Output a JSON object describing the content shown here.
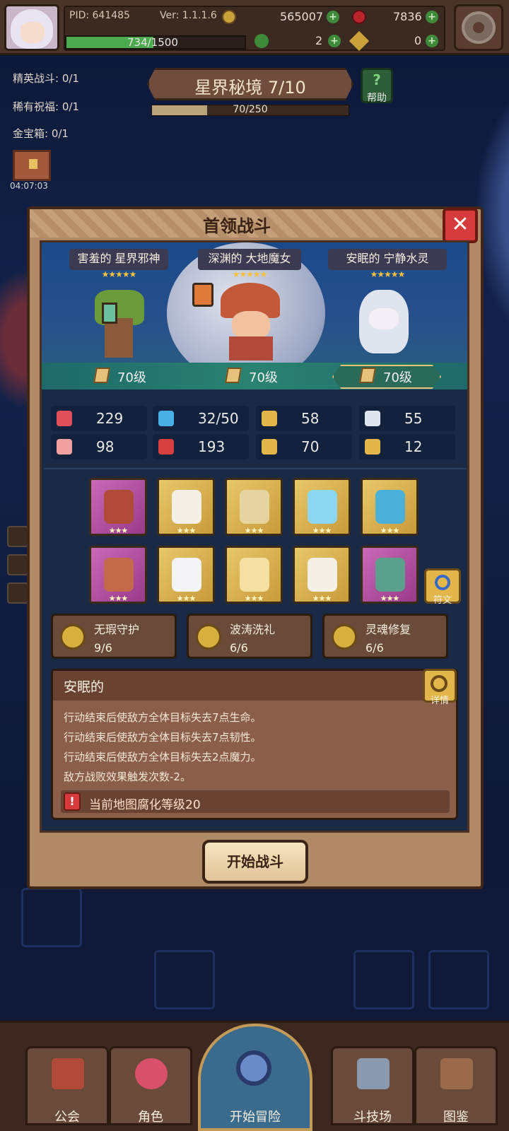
{
  "player": {
    "pid": "PID: 641485",
    "version": "Ver: 1.1.1.6",
    "coins": "565007",
    "gems": "7836",
    "exp": "734/1500",
    "exp_ratio": 0.489,
    "clover": "2",
    "key": "0"
  },
  "quests": [
    {
      "label": "精英战斗: 0/1"
    },
    {
      "label": "稀有祝福: 0/1"
    },
    {
      "label": "金宝箱: 0/1"
    }
  ],
  "chest_timer": "04:07:03",
  "stage": {
    "title": "星界秘境 7/10",
    "progress": "70/250",
    "progress_ratio": 0.28,
    "help_label": "帮助"
  },
  "modal": {
    "title": "首领战斗",
    "enemies": [
      {
        "name": "害羞的 星界邪神",
        "stars": "★★★★★",
        "level": "70级"
      },
      {
        "name": "深渊的 大地魔女",
        "stars": "★★★★★",
        "level": "70级"
      },
      {
        "name": "安眠的 宁静水灵",
        "stars": "★★★★★",
        "level": "70级"
      }
    ],
    "stats": [
      {
        "icon": "heart-icon",
        "value": "229",
        "color": "#e0505a"
      },
      {
        "icon": "mana-drop-icon",
        "value": "32/50",
        "color": "#4ab0e6"
      },
      {
        "icon": "shield-icon",
        "value": "58",
        "color": "#e2b64a"
      },
      {
        "icon": "wing-icon",
        "value": "55",
        "color": "#dfe6f0"
      },
      {
        "icon": "fist-icon",
        "value": "98",
        "color": "#f0a0a0"
      },
      {
        "icon": "book-icon",
        "value": "193",
        "color": "#d64040"
      },
      {
        "icon": "boot-icon",
        "value": "70",
        "color": "#e2b64a"
      },
      {
        "icon": "horseshoe-icon",
        "value": "12",
        "color": "#e2b64a"
      }
    ],
    "equipment": [
      {
        "icon": "axe-icon",
        "rarity": "purple",
        "stars": "★★★"
      },
      {
        "icon": "armor-icon",
        "rarity": "gold",
        "stars": "★★★"
      },
      {
        "icon": "necklace-icon",
        "rarity": "gold",
        "stars": "★★★"
      },
      {
        "icon": "crystal-orb-icon",
        "rarity": "gold",
        "stars": "★★★"
      },
      {
        "icon": "ring-icon",
        "rarity": "gold",
        "stars": "★★★"
      },
      {
        "icon": "helmet-icon",
        "rarity": "purple",
        "stars": "★★★"
      },
      {
        "icon": "cape-icon",
        "rarity": "gold",
        "stars": "★★★"
      },
      {
        "icon": "scroll-icon",
        "rarity": "gold",
        "stars": "★★★"
      },
      {
        "icon": "belt-icon",
        "rarity": "gold",
        "stars": "★★★"
      },
      {
        "icon": "boots-icon",
        "rarity": "purple",
        "stars": "★★★"
      }
    ],
    "rune_label": "符文",
    "skills": [
      {
        "name": "无瑕守护",
        "count": "9/6"
      },
      {
        "name": "波涛洗礼",
        "count": "6/6"
      },
      {
        "name": "灵魂修复",
        "count": "6/6"
      }
    ],
    "desc_title": "安眠的",
    "detail_label": "详情",
    "desc_lines": [
      "行动结束后使敌方全体目标失去7点生命。",
      "行动结束后使敌方全体目标失去7点韧性。",
      "行动结束后使敌方全体目标失去2点魔力。",
      "敌方战败效果触发次数-2。"
    ],
    "warning": "当前地图腐化等级20",
    "start_button": "开始战斗"
  },
  "nav": [
    {
      "label": "公会",
      "icon": "guild-icon"
    },
    {
      "label": "角色",
      "icon": "character-icon"
    },
    {
      "label": "开始冒险",
      "icon": "magnifier-icon"
    },
    {
      "label": "斗技场",
      "icon": "crossed-swords-icon"
    },
    {
      "label": "图鉴",
      "icon": "codex-icon"
    }
  ],
  "colors": {
    "accent_gold": "#e2b64a",
    "close_red": "#d63b3b",
    "exp_green": "#4caa4e"
  }
}
